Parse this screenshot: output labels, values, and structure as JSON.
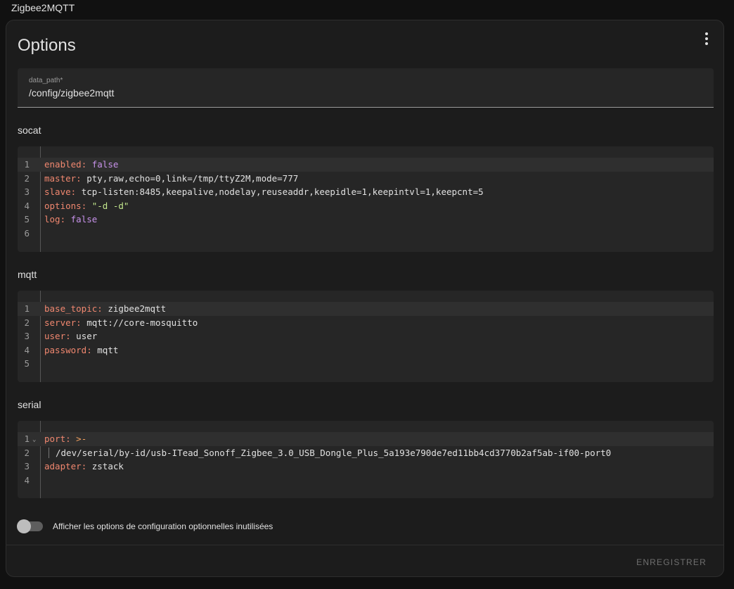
{
  "app": {
    "title": "Zigbee2MQTT"
  },
  "card": {
    "title": "Options"
  },
  "data_path": {
    "label": "data_path*",
    "value": "/config/zigbee2mqtt"
  },
  "socat": {
    "label": "socat",
    "lines": [
      {
        "num": "1",
        "key": "enabled",
        "sep": ": ",
        "value": "false",
        "value_type": "bool"
      },
      {
        "num": "2",
        "key": "master",
        "sep": ": ",
        "value": "pty,raw,echo=0,link=/tmp/ttyZ2M,mode=777",
        "value_type": "plain"
      },
      {
        "num": "3",
        "key": "slave",
        "sep": ": ",
        "value": "tcp-listen:8485,keepalive,nodelay,reuseaddr,keepidle=1,keepintvl=1,keepcnt=5",
        "value_type": "plain"
      },
      {
        "num": "4",
        "key": "options",
        "sep": ": ",
        "value": "\"-d -d\"",
        "value_type": "str"
      },
      {
        "num": "5",
        "key": "log",
        "sep": ": ",
        "value": "false",
        "value_type": "bool"
      },
      {
        "num": "6",
        "key": "",
        "sep": "",
        "value": "",
        "value_type": "plain"
      }
    ]
  },
  "mqtt": {
    "label": "mqtt",
    "lines": [
      {
        "num": "1",
        "key": "base_topic",
        "sep": ": ",
        "value": "zigbee2mqtt",
        "value_type": "plain"
      },
      {
        "num": "2",
        "key": "server",
        "sep": ": ",
        "value": "mqtt://core-mosquitto",
        "value_type": "plain"
      },
      {
        "num": "3",
        "key": "user",
        "sep": ": ",
        "value": "user",
        "value_type": "plain"
      },
      {
        "num": "4",
        "key": "password",
        "sep": ": ",
        "value": "mqtt",
        "value_type": "plain"
      },
      {
        "num": "5",
        "key": "",
        "sep": "",
        "value": "",
        "value_type": "plain"
      }
    ]
  },
  "serial": {
    "label": "serial",
    "lines": [
      {
        "num": "1",
        "key": "port",
        "sep": ": ",
        "value": ">-",
        "value_type": "op",
        "fold": "⌄"
      },
      {
        "num": "2",
        "key": "",
        "sep": "",
        "value": "/dev/serial/by-id/usb-ITead_Sonoff_Zigbee_3.0_USB_Dongle_Plus_5a193e790de7ed11bb4cd3770b2af5ab-if00-port0",
        "value_type": "plain",
        "indent": true
      },
      {
        "num": "3",
        "key": "adapter",
        "sep": ": ",
        "value": "zstack",
        "value_type": "plain"
      },
      {
        "num": "4",
        "key": "",
        "sep": "",
        "value": "",
        "value_type": "plain"
      }
    ]
  },
  "toggle": {
    "label": "Afficher les options de configuration optionnelles inutilisées",
    "checked": false
  },
  "actions": {
    "save_label": "Enregistrer"
  },
  "icons": {
    "more": "more-vertical-icon",
    "fold": "chevron-down-icon"
  },
  "colors": {
    "key": "#f0876f",
    "bool": "#c792ea",
    "string": "#c3e88d",
    "operator": "#f0a060"
  }
}
